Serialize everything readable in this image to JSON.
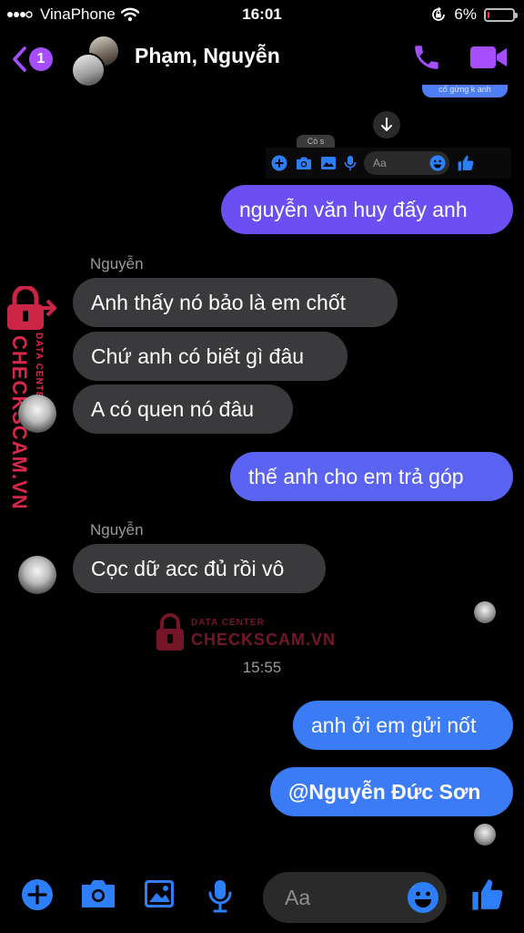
{
  "status_bar": {
    "carrier": "VinaPhone",
    "time": "16:01",
    "battery_percent": "6%",
    "battery_level": 0.06,
    "battery_color": "#ff3b30"
  },
  "header": {
    "back_badge_count": "1",
    "title": "Phạm, Nguyễn",
    "accent_color": "#a64dff"
  },
  "mini_composer": {
    "top_bubble_fragment": "cố gứng k anh",
    "gray_fragment": "Có s",
    "placeholder": "Aa"
  },
  "messages": [
    {
      "id": "m1",
      "direction": "outgoing",
      "text": "nguyễn văn huy đấy anh"
    },
    {
      "id": "s1",
      "sender": "Nguyễn"
    },
    {
      "id": "m2",
      "direction": "incoming",
      "text": "Anh thấy nó bảo là em chốt"
    },
    {
      "id": "m3",
      "direction": "incoming",
      "text": "Chứ anh có biết gì đâu"
    },
    {
      "id": "m4",
      "direction": "incoming",
      "text": "A có quen nó đâu"
    },
    {
      "id": "m5",
      "direction": "outgoing",
      "text": "thế anh cho em trả góp"
    },
    {
      "id": "s2",
      "sender": "Nguyễn"
    },
    {
      "id": "m6",
      "direction": "incoming",
      "text": "Cọc dữ acc đủ rồi vô"
    },
    {
      "id": "t1",
      "timestamp": "15:55"
    },
    {
      "id": "m7",
      "direction": "outgoing",
      "text": "anh ởi em gửi nốt"
    },
    {
      "id": "m8",
      "direction": "outgoing",
      "text": "@Nguyễn Đức Sơn"
    }
  ],
  "watermark": {
    "main_text": "CHECKSCAM.VN",
    "sub_text": "DATA CENTER",
    "color": "#d6284a"
  },
  "composer": {
    "placeholder": "Aa",
    "accent_color": "#2d7ff9"
  }
}
